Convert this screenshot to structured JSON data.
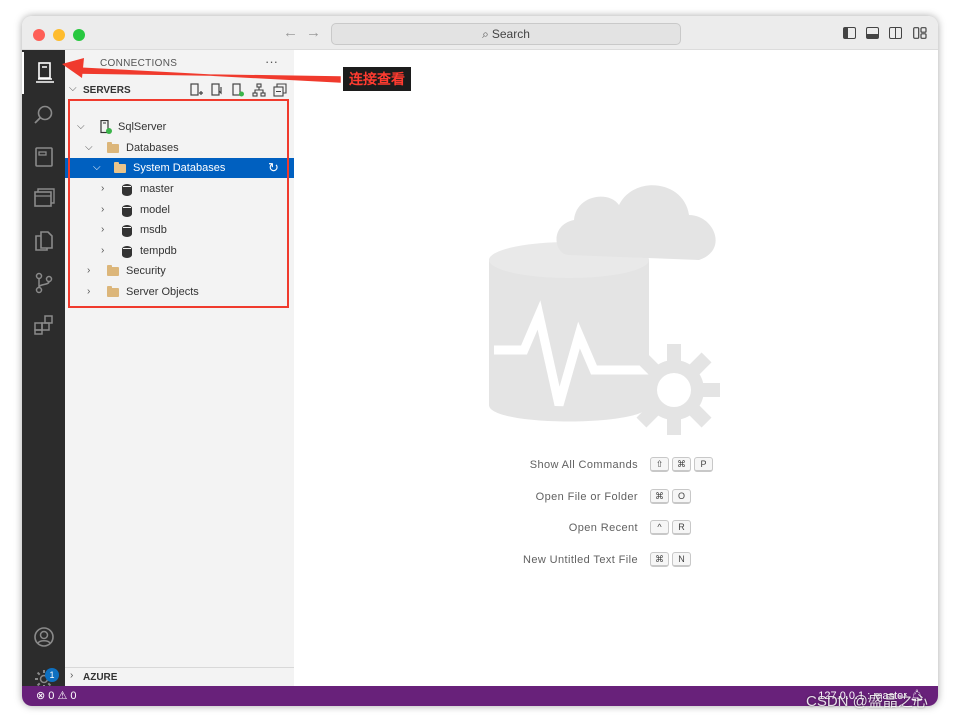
{
  "titlebar": {
    "search_label": "Search",
    "nav_back": "←",
    "nav_forward": "→"
  },
  "sidebar": {
    "connections_title": "CONNECTIONS",
    "more": "···",
    "servers_label": "SERVERS",
    "tree": {
      "server": "SqlServer",
      "databases": "Databases",
      "system_databases": "System Databases",
      "dbs": [
        "master",
        "model",
        "msdb",
        "tempdb"
      ],
      "security": "Security",
      "server_objects": "Server Objects"
    },
    "azure_label": "AZURE"
  },
  "editor": {
    "commands": [
      {
        "label": "Show All Commands",
        "keys": [
          "⇧",
          "⌘",
          "P"
        ]
      },
      {
        "label": "Open File or Folder",
        "keys": [
          "⌘",
          "O"
        ]
      },
      {
        "label": "Open Recent",
        "keys": [
          "^",
          "R"
        ]
      },
      {
        "label": "New Untitled Text File",
        "keys": [
          "⌘",
          "N"
        ]
      }
    ]
  },
  "activitybar": {
    "settings_badge": "1"
  },
  "statusbar": {
    "errors": "0",
    "warnings": "0",
    "connection": "127.0.0.1 : master"
  },
  "annotation": {
    "callout_text": "连接查看",
    "watermark": "CSDN @盛晶之心"
  },
  "colors": {
    "statusbar": "#68217a",
    "selection": "#0060c0",
    "annotation_red": "#f03a2d",
    "activitybar": "#2c2c2c"
  }
}
